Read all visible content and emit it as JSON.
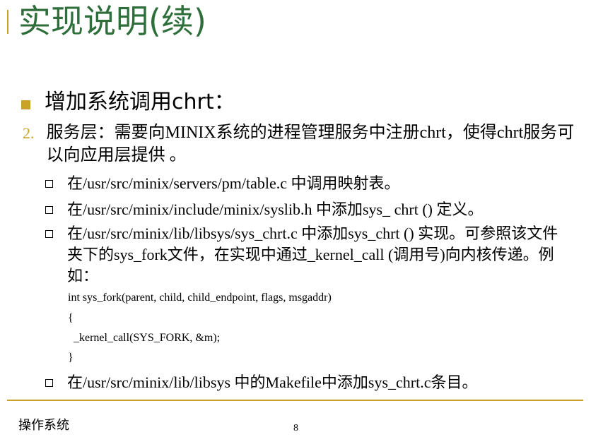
{
  "title": "实现说明(续)",
  "heading": "增加系统调用chrt：",
  "step": {
    "number": "2.",
    "text": "服务层：需要向MINIX系统的进程管理服务中注册chrt，使得chrt服务可以向应用层提供 。"
  },
  "items": [
    "在/usr/src/minix/servers/pm/table.c 中调用映射表。",
    "在/usr/src/minix/include/minix/syslib.h 中添加sys_ chrt () 定义。",
    "在/usr/src/minix/lib/libsys/sys_chrt.c 中添加sys_chrt () 实现。可参照该文件夹下的sys_fork文件，在实现中通过_kernel_call (调用号)向内核传递。例如：",
    "在/usr/src/minix/lib/libsys 中的Makefile中添加sys_chrt.c条目。"
  ],
  "code": [
    "int sys_fork(parent, child, child_endpoint, flags, msgaddr)",
    "{",
    "  _kernel_call(SYS_FORK, &m);",
    "}"
  ],
  "footer": {
    "left": "操作系统",
    "page": "8"
  }
}
